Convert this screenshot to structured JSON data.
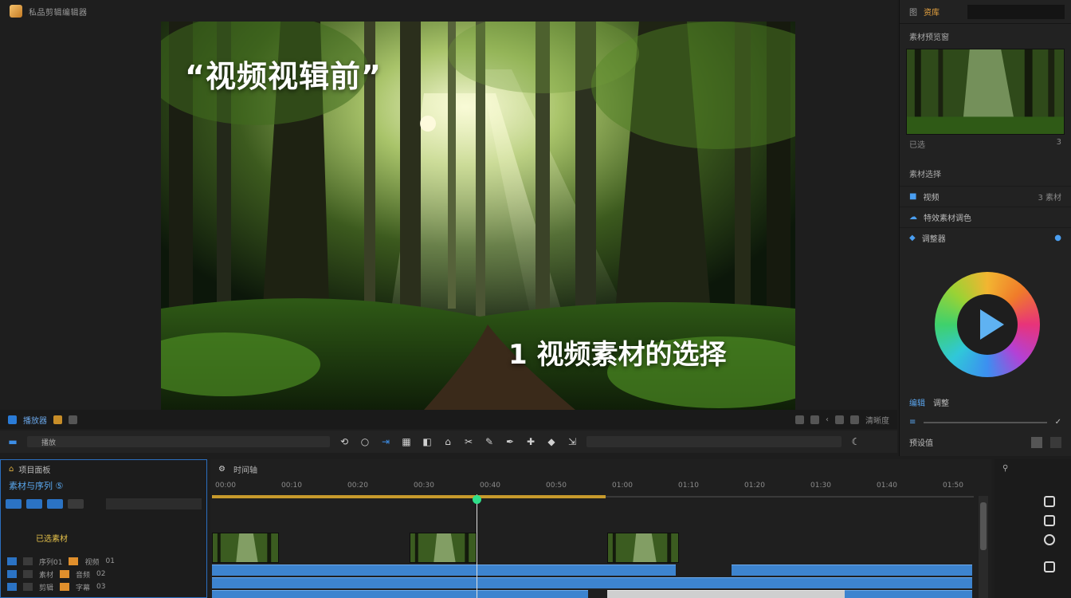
{
  "app": {
    "title": "私品剪辑编辑器"
  },
  "preview": {
    "overlay_top": "“视频视辑前”",
    "overlay_bottom": "1 视频素材的选择"
  },
  "player_strip": {
    "left_label": "播放器",
    "right_label": "清晰度"
  },
  "toolbar": {
    "scrub_label": "播放"
  },
  "right_panel": {
    "tabs": [
      "图",
      "资库"
    ],
    "section_title": "素材预览窗",
    "thumb_meta_left": "已选",
    "thumb_meta_right": "3",
    "list_title": "素材选择",
    "rows": [
      {
        "label": "视频",
        "right": "3 素材",
        "icon": "video-icon"
      },
      {
        "label": "特效素材调色",
        "right": "",
        "icon": "cloud-icon"
      },
      {
        "label": "调整器",
        "right": "●",
        "icon": "diamond-icon"
      }
    ],
    "bottom_tabs": [
      "编辑",
      "调整"
    ],
    "preset_label": "预设值"
  },
  "project": {
    "header": "项目面板",
    "title": "素材与序列 ⑤",
    "folder": "已选素材",
    "rows": [
      {
        "name": "序列01",
        "a": "视频",
        "b": "01"
      },
      {
        "name": "素材",
        "a": "音频",
        "b": "02"
      },
      {
        "name": "剪辑",
        "a": "字幕",
        "b": "03"
      }
    ]
  },
  "timeline": {
    "header": "时间轴",
    "ticks": [
      "00:00",
      "00:10",
      "00:20",
      "00:30",
      "00:40",
      "00:50",
      "01:00",
      "01:10",
      "01:20",
      "01:30",
      "01:40",
      "01:50"
    ],
    "playhead_time": "00:40"
  },
  "colors": {
    "accent_blue": "#3d84cf",
    "workbar_gold": "#c79a2c",
    "playhead_green": "#2fe08a"
  }
}
